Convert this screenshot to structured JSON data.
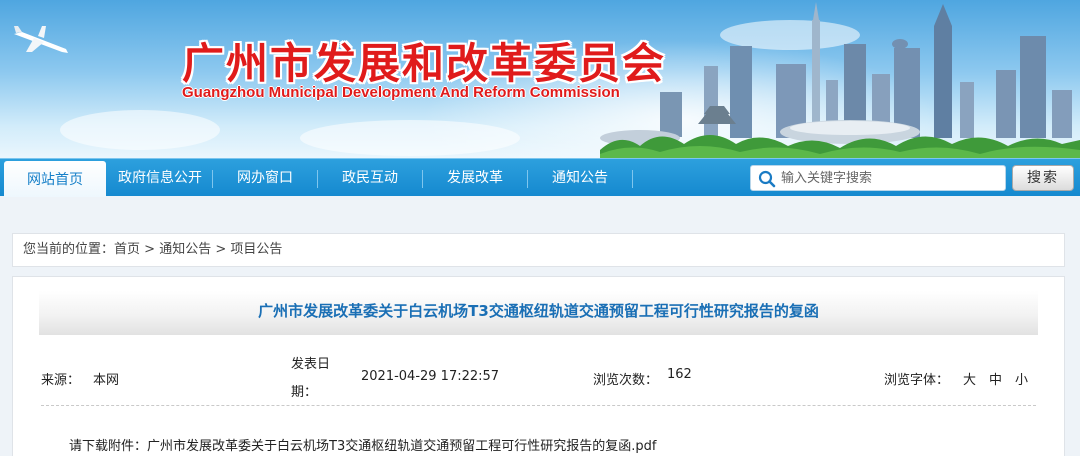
{
  "header": {
    "title_cn": "广州市发展和改革委员会",
    "title_en": "Guangzhou Municipal Development And Reform Commission"
  },
  "nav": {
    "items": [
      {
        "label": "网站首页",
        "active": true
      },
      {
        "label": "政府信息公开",
        "active": false
      },
      {
        "label": "网办窗口",
        "active": false
      },
      {
        "label": "政民互动",
        "active": false
      },
      {
        "label": "发展改革",
        "active": false
      },
      {
        "label": "通知公告",
        "active": false
      }
    ],
    "search_placeholder": "输入关键字搜索",
    "search_button": "搜索"
  },
  "breadcrumb": {
    "prefix": "您当前的位置：",
    "items": [
      "首页",
      "通知公告",
      "项目公告"
    ],
    "separator": " > "
  },
  "article": {
    "title": "广州市发展改革委关于白云机场T3交通枢纽轨道交通预留工程可行性研究报告的复函",
    "source_label": "来源：",
    "source_value": "本网",
    "date_label_line1": "发表日",
    "date_label_line2": "期：",
    "date_value": "2021-04-29 17:22:57",
    "views_label": "浏览次数：",
    "views_value": "162",
    "font_label": "浏览字体：",
    "font_large": "大",
    "font_medium": "中",
    "font_small": "小",
    "attachment_label": "请下载附件：",
    "attachment_name": "广州市发展改革委关于白云机场T3交通枢纽轨道交通预留工程可行性研究报告的复函.pdf"
  },
  "colors": {
    "nav_blue": "#1589cf",
    "title_red": "#e01b1b",
    "article_title_blue": "#1a6fb5"
  }
}
